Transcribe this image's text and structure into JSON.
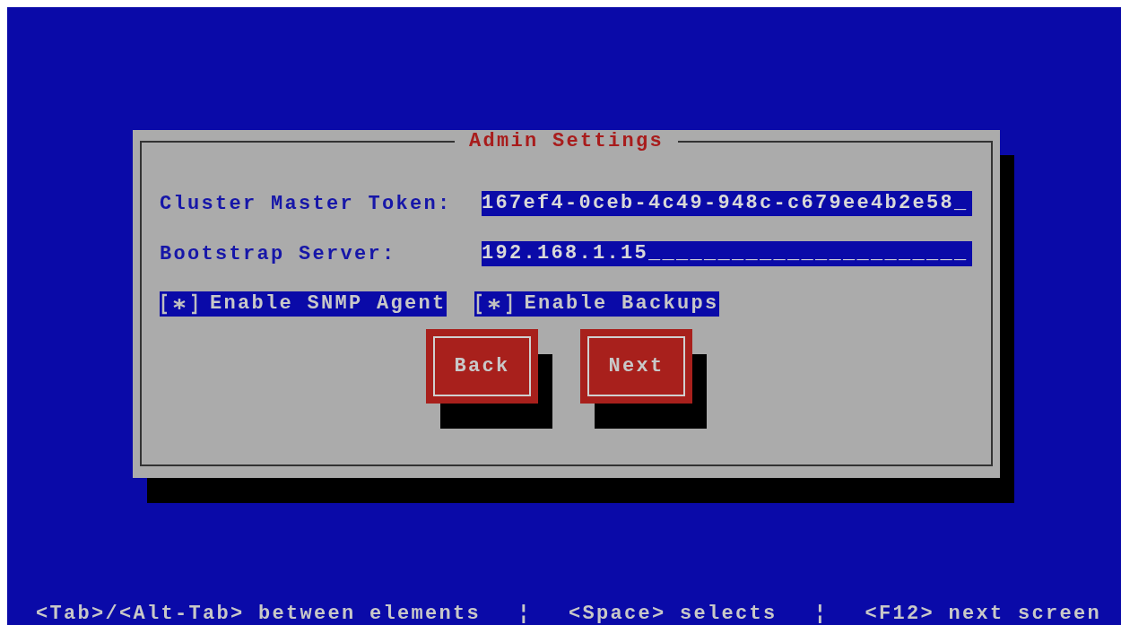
{
  "dialog": {
    "title": "Admin Settings",
    "fields": [
      {
        "label": "Cluster Master Token:",
        "value": "167ef4-0ceb-4c49-948c-c679ee4b2e58_"
      },
      {
        "label": "Bootstrap Server:",
        "value": "192.168.1.15_______________________"
      }
    ],
    "checkboxes": [
      {
        "label": "Enable SNMP Agent",
        "checked": true
      },
      {
        "label": "Enable Backups",
        "checked": true
      }
    ],
    "buttons": [
      "Back",
      "Next"
    ]
  },
  "help_bar": [
    "<Tab>/<Alt-Tab> between elements",
    "¦",
    "<Space> selects",
    "¦",
    "<F12> next screen"
  ]
}
